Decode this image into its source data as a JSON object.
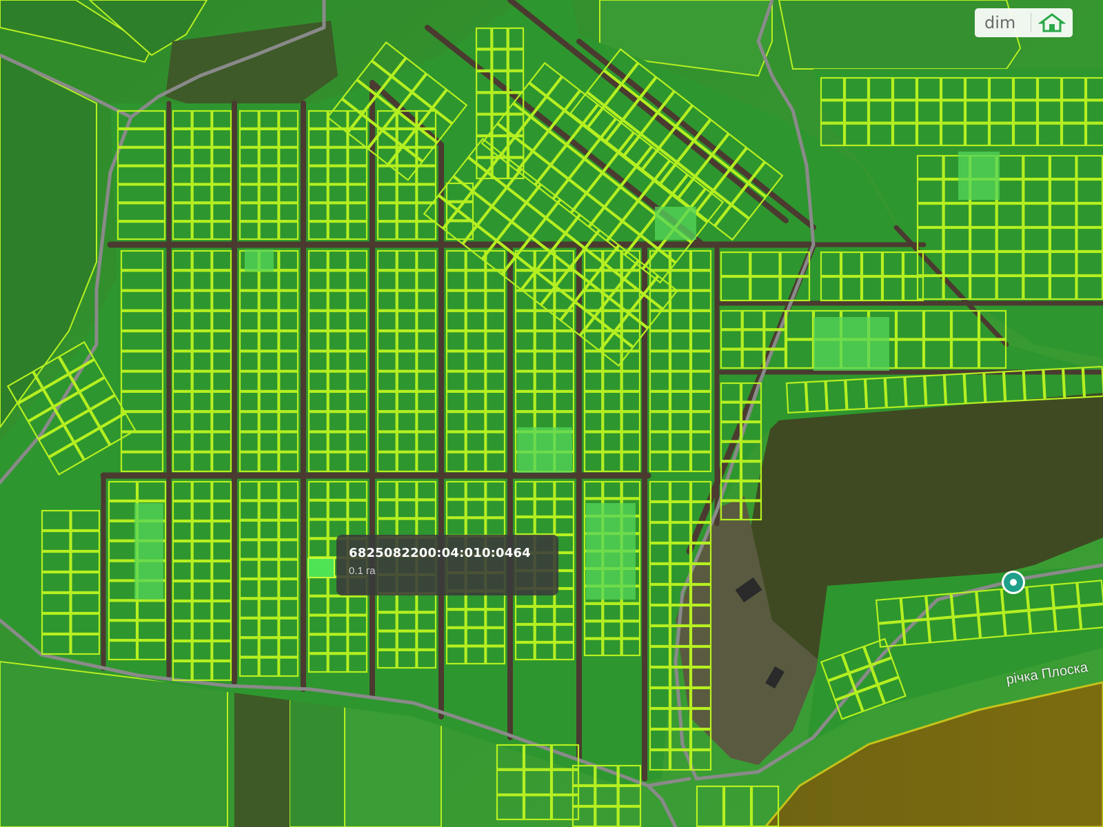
{
  "map": {
    "colors": {
      "parcel_fill": "#2c8f2c",
      "parcel_border": "#b6f021",
      "road": "#4a3a30",
      "field_dark": "#2f7a2a",
      "field_light": "#3a9a34",
      "forest": "#3e4a22",
      "water": "#7a6a12",
      "highlight": "#55d65a"
    }
  },
  "tooltip": {
    "cadastral_number": "6825082200:04:010:0464",
    "area": "0.1 га"
  },
  "logo": {
    "text": "dim",
    "icon": "ria-house-icon"
  },
  "labels": {
    "river": "річка Плоска"
  },
  "marker": {
    "icon": "location-pin-icon",
    "color": "#1fa08a"
  }
}
